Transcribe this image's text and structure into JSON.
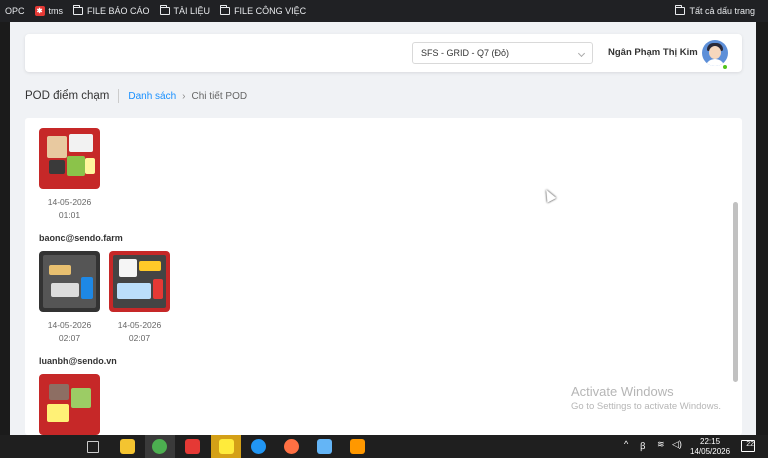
{
  "bookmarks": {
    "items": [
      {
        "label": "OPC",
        "icon": "none"
      },
      {
        "label": "tms",
        "icon": "tms-icon"
      },
      {
        "label": "FILE BÁO CÁO",
        "icon": "folder-icon"
      },
      {
        "label": "TÀI LIỆU",
        "icon": "folder-icon"
      },
      {
        "label": "FILE CÔNG VIỆC",
        "icon": "folder-icon"
      }
    ],
    "all_bookmarks": "Tất cả dấu trang"
  },
  "header": {
    "store_select": "SFS - GRID - Q7 (Đỏ)",
    "user_name": "Ngân Phạm Thị Kim"
  },
  "breadcrumb": {
    "page_title": "POD điểm chạm",
    "link": "Danh sách",
    "current": "Chi tiết POD"
  },
  "pod_groups": [
    {
      "email": "",
      "photos": [
        {
          "date": "14-05-2026",
          "time": "01:01"
        }
      ]
    },
    {
      "email": "baonc@sendo.farm",
      "photos": [
        {
          "date": "14-05-2026",
          "time": "02:07"
        },
        {
          "date": "14-05-2026",
          "time": "02:07"
        }
      ]
    },
    {
      "email": "luanbh@sendo.vn",
      "photos": [
        {
          "date": "",
          "time": ""
        }
      ]
    }
  ],
  "watermark": {
    "line1": "Activate Windows",
    "line2": "Go to Settings to activate Windows."
  },
  "taskbar": {
    "time": "22:15",
    "date": "14/05/2026",
    "notifications": "22"
  },
  "colors": {
    "accent": "#1890ff",
    "basket_red": "#d32f2f",
    "online": "#52c41a"
  }
}
